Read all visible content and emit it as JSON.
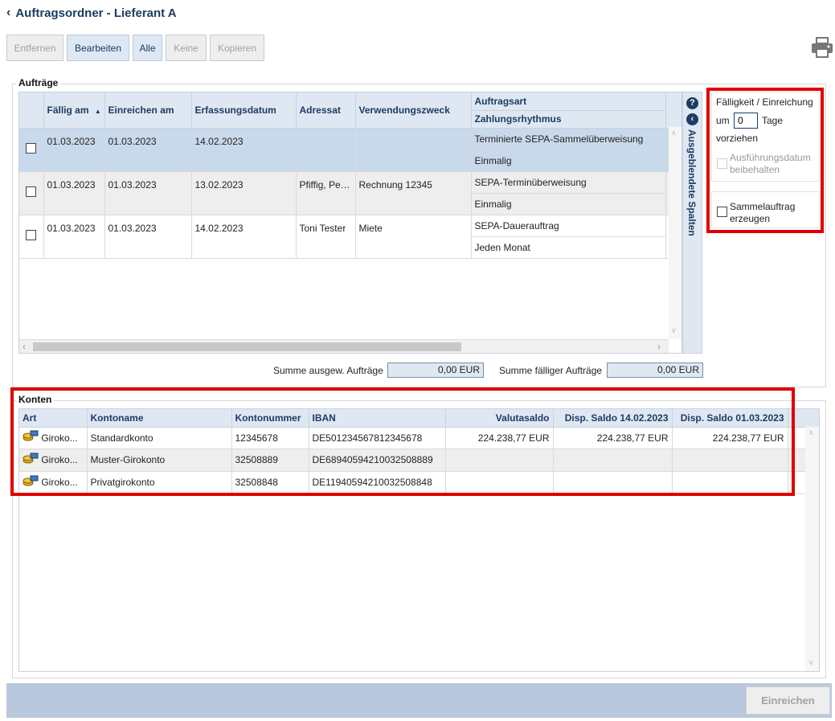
{
  "page": {
    "title": "Auftragsordner - Lieferant A"
  },
  "toolbar": {
    "remove": "Entfernen",
    "edit": "Bearbeiten",
    "all": "Alle",
    "none": "Keine",
    "copy": "Kopieren"
  },
  "orders": {
    "legend": "Aufträge",
    "columns": {
      "due": "Fällig am",
      "submit": "Einreichen am",
      "captured": "Erfassungsdatum",
      "addressee": "Adressat",
      "purpose": "Verwendungszweck",
      "type": "Auftragsart",
      "rhythm": "Zahlungsrhythmus"
    },
    "rows": [
      {
        "due": "01.03.2023",
        "submit": "01.03.2023",
        "captured": "14.02.2023",
        "addressee": "",
        "purpose": "",
        "type": "Terminierte SEPA-Sammelüberweisung",
        "rhythm": "Einmalig"
      },
      {
        "due": "01.03.2023",
        "submit": "01.03.2023",
        "captured": "13.02.2023",
        "addressee": "Pfiffig, Petra",
        "purpose": "Rechnung 12345",
        "type": "SEPA-Terminüberweisung",
        "rhythm": "Einmalig"
      },
      {
        "due": "01.03.2023",
        "submit": "01.03.2023",
        "captured": "14.02.2023",
        "addressee": "Toni Tester",
        "purpose": "Miete",
        "type": "SEPA-Dauerauftrag",
        "rhythm": "Jeden Monat"
      }
    ],
    "hidden_columns": "Ausgeblendete Spalten",
    "sum_selected_label": "Summe ausgew. Aufträge",
    "sum_selected_value": "0,00 EUR",
    "sum_due_label": "Summe fälliger Aufträge",
    "sum_due_value": "0,00 EUR"
  },
  "side_panel": {
    "heading": "Fälligkeit / Einreichung",
    "um": "um",
    "days_value": "0",
    "days_label": "Tage",
    "advance": "vorziehen",
    "keep_date": "Ausführungsdatum beibehalten",
    "collective": "Sammelauftrag erzeugen"
  },
  "accounts": {
    "legend": "Konten",
    "columns": {
      "type": "Art",
      "name": "Kontoname",
      "number": "Kontonummer",
      "iban": "IBAN",
      "valuta": "Valutasaldo",
      "disp1": "Disp. Saldo 14.02.2023",
      "disp2": "Disp. Saldo 01.03.2023"
    },
    "rows": [
      {
        "type": "Giroko...",
        "name": "Standardkonto",
        "number": "12345678",
        "iban": "DE501234567812345678",
        "valuta": "224.238,77 EUR",
        "disp1": "224.238,77 EUR",
        "disp2": "224.238,77 EUR"
      },
      {
        "type": "Giroko...",
        "name": "Muster-Girokonto",
        "number": "32508889",
        "iban": "DE68940594210032508889",
        "valuta": "",
        "disp1": "",
        "disp2": ""
      },
      {
        "type": "Giroko...",
        "name": "Privatgirokonto",
        "number": "32508848",
        "iban": "DE11940594210032508848",
        "valuta": "",
        "disp1": "",
        "disp2": ""
      }
    ]
  },
  "footer": {
    "submit": "Einreichen"
  }
}
